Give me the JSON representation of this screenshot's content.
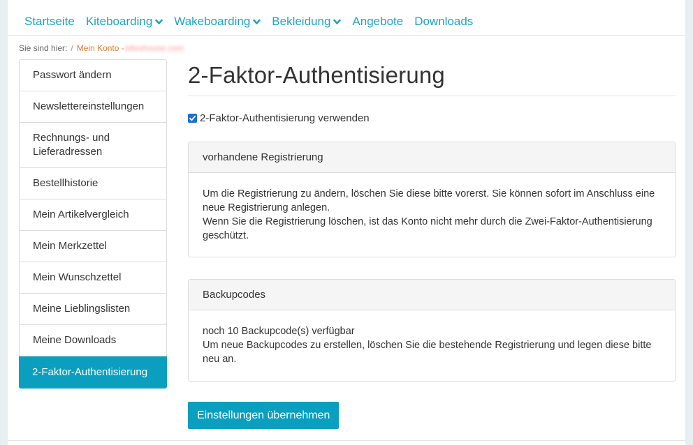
{
  "nav": {
    "items": [
      {
        "label": "Startseite",
        "dropdown": false
      },
      {
        "label": "Kiteboarding",
        "dropdown": true
      },
      {
        "label": "Wakeboarding",
        "dropdown": true
      },
      {
        "label": "Bekleidung",
        "dropdown": true
      },
      {
        "label": "Angebote",
        "dropdown": false
      },
      {
        "label": "Downloads",
        "dropdown": false
      }
    ]
  },
  "breadcrumb": {
    "prefix": "Sie sind hier:",
    "separator": "/",
    "current": "Mein Konto -",
    "redacted": "kiteshouse.com"
  },
  "sidebar": {
    "items": [
      {
        "label": "Passwort ändern"
      },
      {
        "label": "Newslettereinstellungen"
      },
      {
        "label": "Rechnungs- und Lieferadressen"
      },
      {
        "label": "Bestellhistorie"
      },
      {
        "label": "Mein Artikelvergleich"
      },
      {
        "label": "Mein Merkzettel"
      },
      {
        "label": "Mein Wunschzettel"
      },
      {
        "label": "Meine Lieblingslisten"
      },
      {
        "label": "Meine Downloads"
      },
      {
        "label": "2-Faktor-Authentisierung",
        "active": true
      }
    ]
  },
  "main": {
    "title": "2-Faktor-Authentisierung",
    "checkbox": {
      "label": "2-Faktor-Authentisierung verwenden",
      "checked": true
    },
    "registration_panel": {
      "heading": "vorhandene Registrierung",
      "text1": "Um die Registrierung zu ändern, löschen Sie diese bitte vorerst. Sie können sofort im Anschluss eine neue Registrierung anlegen.",
      "text2": "Wenn Sie die Registrierung löschen, ist das Konto nicht mehr durch die Zwei-Faktor-Authentisierung geschützt."
    },
    "backup_panel": {
      "heading": "Backupcodes",
      "text1": "noch 10 Backupcode(s) verfügbar",
      "text2": "Um neue Backupcodes zu erstellen, löschen Sie die bestehende Registrierung und legen diese bitte neu an."
    },
    "submit_label": "Einstellungen übernehmen"
  },
  "colors": {
    "accent": "#0a9fbe",
    "nav_link": "#1ea4c2",
    "breadcrumb_link": "#e07b3a",
    "checkbox": "#1a6fd6"
  }
}
